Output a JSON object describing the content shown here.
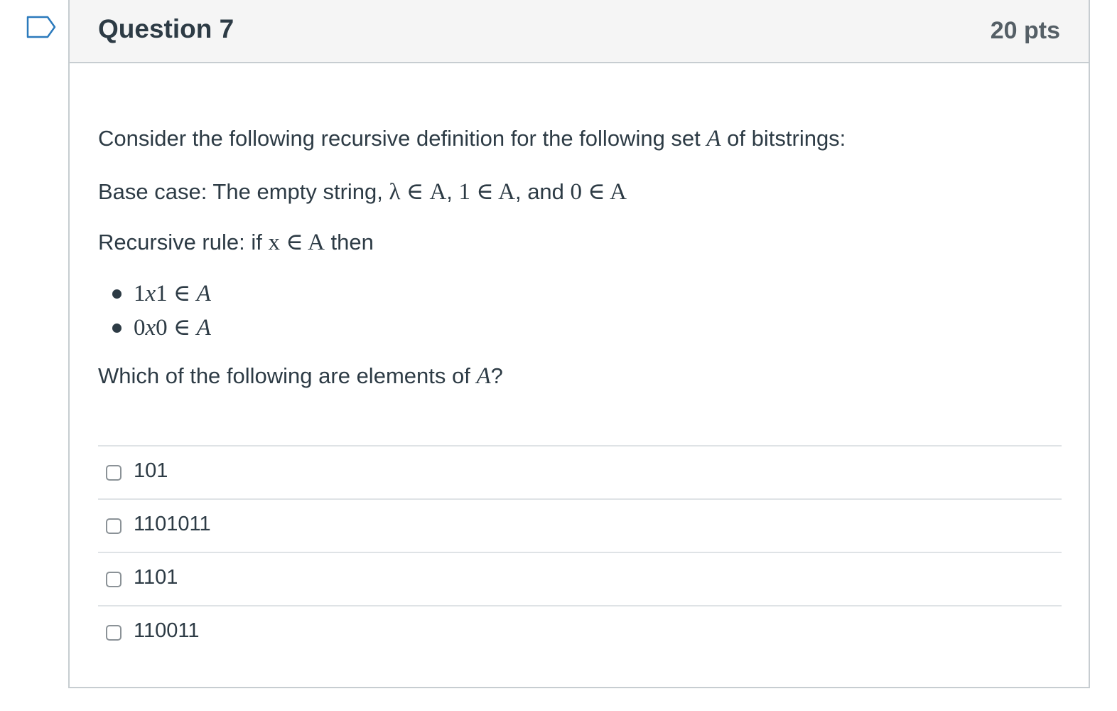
{
  "question": {
    "title": "Question 7",
    "points": "20 pts",
    "intro": {
      "before": "Consider the following recursive definition for the following set ",
      "set_var": "A",
      "after": " of bitstrings:"
    },
    "base_case": {
      "label": "Base case: The empty string, ",
      "m1": "λ ∈ A",
      "sep1": ", ",
      "m2": "1 ∈ A",
      "sep2": ", and ",
      "m3": "0 ∈ A"
    },
    "recursive_rule": {
      "label": "Recursive rule: if ",
      "cond": "x ∈ A",
      "after": " then"
    },
    "rules": [
      {
        "pre": "1",
        "var": "x",
        "post": "1 ∈ ",
        "set": "A"
      },
      {
        "pre": "0",
        "var": "x",
        "post": "0 ∈ ",
        "set": "A"
      }
    ],
    "prompt": {
      "before": "Which of the following are elements of ",
      "set_var": "A",
      "after": "?"
    },
    "answers": [
      {
        "label": "101",
        "checked": false
      },
      {
        "label": "1101011",
        "checked": false
      },
      {
        "label": "1101",
        "checked": false
      },
      {
        "label": "110011",
        "checked": false
      }
    ]
  },
  "colors": {
    "text": "#2d3b45",
    "header_bg": "#f5f5f5",
    "border": "#c7cdd1",
    "flag_icon": "#2b7abc"
  },
  "icons": {
    "flag": "flag-icon",
    "checkbox": "checkbox-icon"
  }
}
